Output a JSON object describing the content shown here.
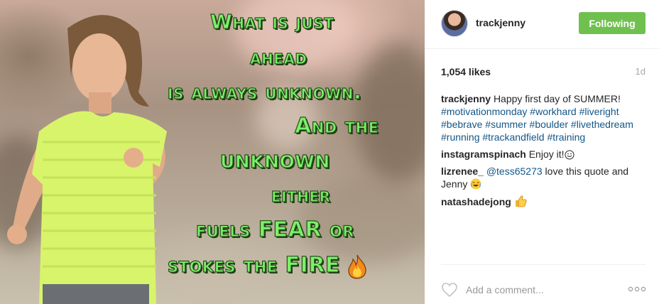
{
  "post": {
    "quote_lines": [
      "What is just",
      "ahead",
      "is always unknown.",
      "And the",
      "unknown",
      "either",
      "fuels FEAR or",
      "stokes the FIRE"
    ]
  },
  "header": {
    "username": "trackjenny",
    "follow_label": "Following"
  },
  "stats": {
    "likes": "1,054 likes",
    "time": "1d"
  },
  "caption": {
    "user": "trackjenny",
    "text": "Happy first day of SUMMER!",
    "hashtags": [
      "#motivationmonday",
      "#workhard",
      "#liveright",
      "#bebrave",
      "#summer",
      "#boulder",
      "#livethedream",
      "#running",
      "#trackandfield",
      "#training"
    ]
  },
  "comments": [
    {
      "user": "instagramspinach",
      "text": "Enjoy it!",
      "emoji": "smile-emoji"
    },
    {
      "user": "lizrenee_",
      "mention": "@tess65273",
      "text": "love this quote and Jenny",
      "emoji": "laughing-emoji"
    },
    {
      "user": "natashadejong",
      "text": "",
      "emoji": "thumbs-up-emoji"
    }
  ],
  "footer": {
    "placeholder": "Add a comment..."
  },
  "colors": {
    "follow_button": "#70c050",
    "hashtag": "#125688",
    "quote_text": "#7cf06a"
  },
  "icons": [
    "heart-icon",
    "more-options-icon",
    "fire-emoji"
  ]
}
